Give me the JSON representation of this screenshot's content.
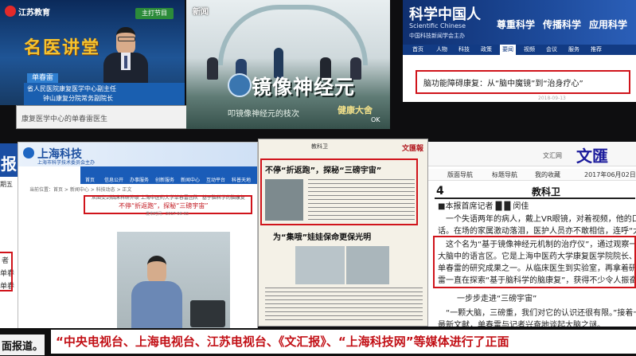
{
  "tv_news": {
    "channel": "江苏教育",
    "corner_badge": "主打节目",
    "show_title": "名医讲堂",
    "caption_name": "单春雷",
    "caption_line1": "省人民医院康复医学中心副主任",
    "caption_line2": "钟山康复分院常务副院长",
    "ticker": "康复医学中心的单春雷医生"
  },
  "tv_studio": {
    "station_logo": "新闻",
    "big_title": "镜像神经元",
    "subtitle": "叩镜像神经元的枝次",
    "show_brand": "健康大舍",
    "ok": "OK"
  },
  "sci_chinese": {
    "logo_cn": "科学中国人",
    "logo_en": "Scientific Chinese",
    "logo_sub": "中国科技新闻学会主办",
    "slogans": [
      "尊重科学",
      "传播科学",
      "应用科学"
    ],
    "nav": [
      "首页",
      "人物",
      "科技",
      "政策",
      "要闻",
      "视频",
      "会议",
      "服务",
      "推荐"
    ],
    "headline": "脑功能障碍康复：从“脑中魔镜”到“治身疗心”",
    "date": "2018-09-13"
  },
  "left_strip": {
    "top_char": "报",
    "week": "期五",
    "items": [
      "者",
      "单春",
      "单春"
    ]
  },
  "sh_tech": {
    "logo": "上海科技",
    "logo_sub": "上海市科学技术委员会主办",
    "nav": [
      "首页",
      "信息公开",
      "办事服务",
      "创新服务",
      "新闻中心",
      "互动平台",
      "科普天地"
    ],
    "breadcrumb": "当前位置：首页 > 新闻中心 > 科技动态 > 正文",
    "article_meta": "从图交到临床科研外联 上海中医药大学单春雷团队 “基于脑科学的脑康复”",
    "article_title": "不停“折返跑”，探秘“三磅宇宙”",
    "article_date": "发布时间：2017-06-02"
  },
  "newspaper": {
    "masthead": "文匯報",
    "section": "教科卫",
    "headline1": "不停“折返跑”，探秘“三磅宇宙”",
    "headline2": "为“集哦”娃娃保命更保光明",
    "page_badge": "教科卫"
  },
  "wenhui": {
    "logo": "文匯",
    "channel": "文汇网",
    "nav": [
      "版面导航",
      "标题导航",
      "我的收藏"
    ],
    "date": "2017年06月02日",
    "page_no": "4",
    "page_name": "教科卫",
    "byline": "■本报首席记者 █ █ 闵佳",
    "paragraphs": [
      "一个失语两年的病人，戴上VR眼镜，对着视频，他的口中开始蹦出一些",
      "话。在场的家属激动落泪，医护人员亦不敢相信，连呼“太神奇”。",
      "这个名为“基于镜像神经元机制的治疗仪”，通过观察一些动作，激活患",
      "大脑中的语言区。它是上海中医药大学康复医学院院长、康复医学研究所",
      "单春雷的研究成果之一。从临床医生到实验室，再拿着研制成果回到临床，",
      "雷一直在探索“基于脑科学的脑康复”，获得不少令人振奋的发现。",
      "一步步走进“三磅宇宙”",
      "“一颗大脑，三磅重，我们对它的认识还很有限。”接着一叠脑科学资",
      "最新文献，单春雷与记者兴奋地谈起大脑之谜。"
    ]
  },
  "bottom_caption": {
    "left": "面报道。",
    "main": "“中央电视台、上海电视台、江苏电视台、《文汇报》、“上海科技网”等媒体进行了正面"
  }
}
